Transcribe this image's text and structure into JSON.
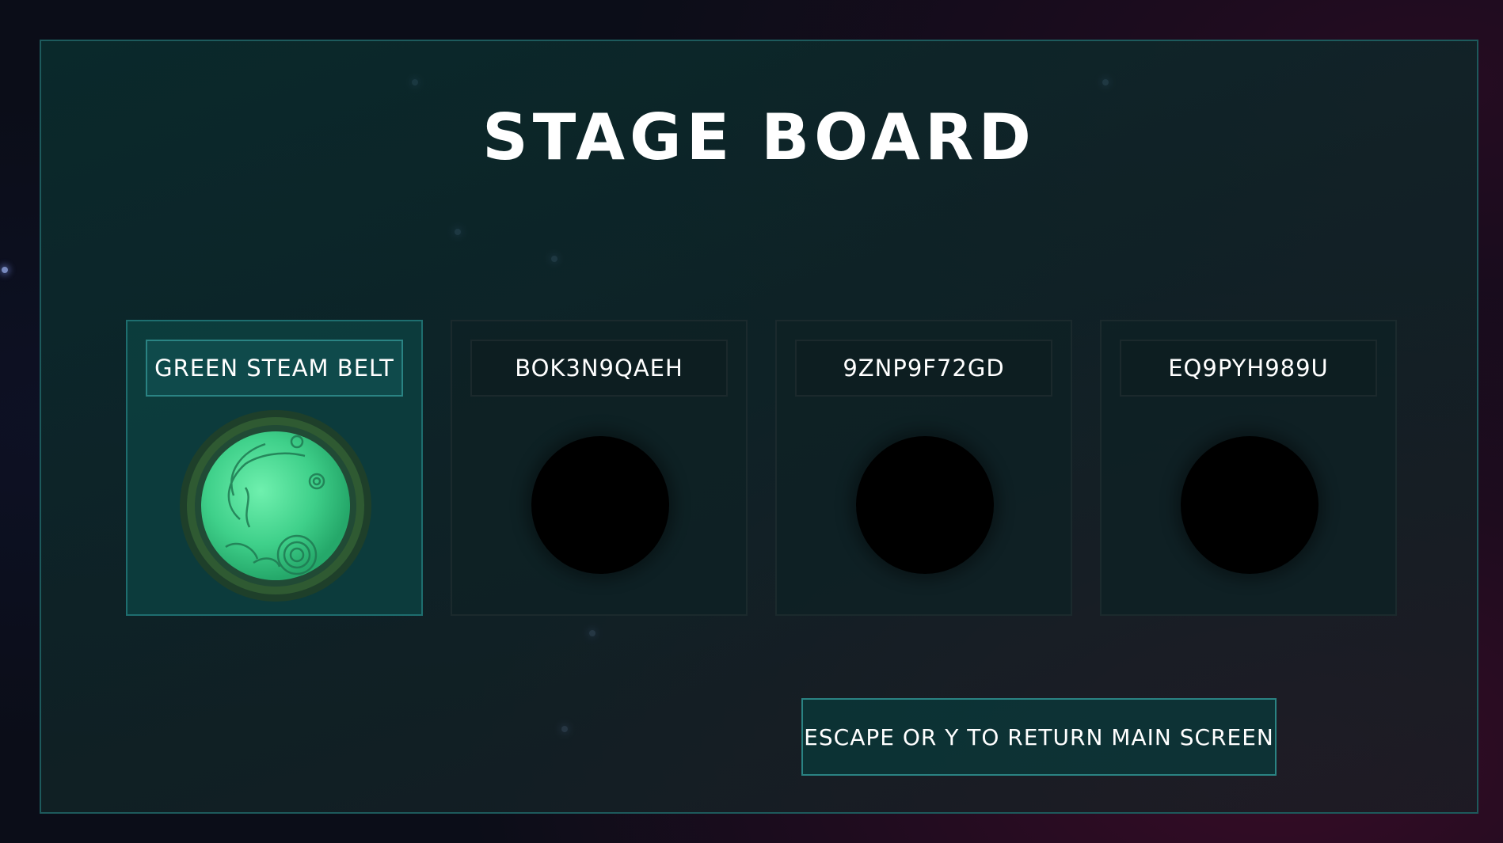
{
  "screen": {
    "title": "STAGE BOARD"
  },
  "stages": [
    {
      "label": "GREEN STEAM BELT",
      "state": "unlocked",
      "planet": "green-planet-icon"
    },
    {
      "label": "BOK3N9QAEH",
      "state": "locked",
      "planet": "dark-planet-slot"
    },
    {
      "label": "9ZNP9F72GD",
      "state": "locked",
      "planet": "dark-planet-slot"
    },
    {
      "label": "EQ9PYH989U",
      "state": "locked",
      "planet": "dark-planet-slot"
    }
  ],
  "footer": {
    "return_hint": "ESCAPE OR Y TO RETURN MAIN SCREEN"
  },
  "colors": {
    "accent": "#2a8383",
    "active_card": "#0c3e3e",
    "planet_green": "#4fd896",
    "planet_ring": "#2f5a32"
  }
}
